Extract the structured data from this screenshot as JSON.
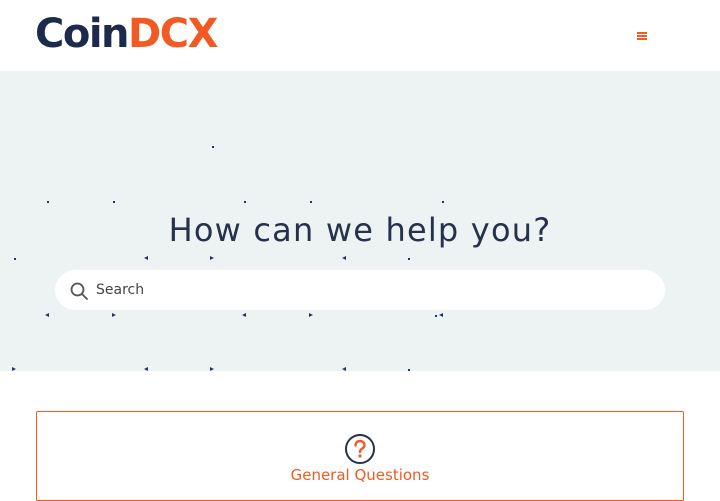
{
  "brand": {
    "part1": "Coin",
    "part2": "DCX",
    "primary_color": "#1c2a4e",
    "accent_color": "#f15a22"
  },
  "header": {
    "menu_icon": "hamburger-menu-icon"
  },
  "hero": {
    "title": "How can we help you?",
    "background": "#edf2f2"
  },
  "search": {
    "placeholder": "Search",
    "icon": "search-icon"
  },
  "categories": [
    {
      "title": "General Questions",
      "icon": "question-circle-icon"
    }
  ]
}
